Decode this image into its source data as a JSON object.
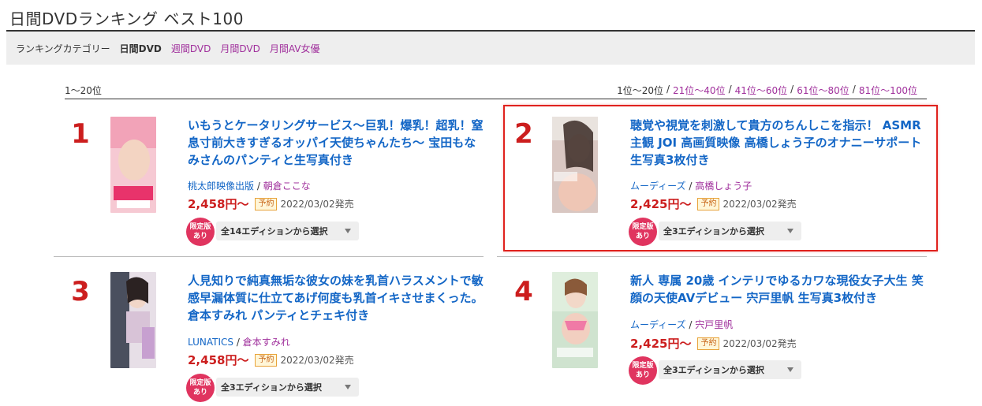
{
  "page_title": "日間DVDランキング ベスト100",
  "category_bar": {
    "label": "ランキングカテゴリー",
    "current": "日間DVD",
    "links": [
      "週間DVD",
      "月間DVD",
      "月間AV女優"
    ]
  },
  "range_label": "1〜20位",
  "pager": {
    "current": "1位〜20位",
    "links": [
      "21位〜40位",
      "41位〜60位",
      "61位〜80位",
      "81位〜100位"
    ],
    "separator": "/"
  },
  "items": [
    {
      "rank": "1",
      "title": "いもうとケータリングサービス〜巨乳！爆乳！超乳！窒息寸前大きすぎるオッパイ天使ちゃんたち〜 宝田もなみさんのパンティと生写真付き",
      "maker": "桃太郎映像出版",
      "actress": "朝倉ここな",
      "price": "2,458円〜",
      "badge": "予約",
      "release": "2022/03/02発売",
      "limited_line1": "限定版",
      "limited_line2": "あり",
      "edition": "全14エディションから選択"
    },
    {
      "rank": "2",
      "title": "聴覚や視覚を刺激して貴方のちんしこを指示！ ASMR主観 JOI 高画質映像 高橋しょう子のオナニーサポート 生写真3枚付き",
      "maker": "ムーディーズ",
      "actress": "高橋しょう子",
      "price": "2,425円〜",
      "badge": "予約",
      "release": "2022/03/02発売",
      "limited_line1": "限定版",
      "limited_line2": "あり",
      "edition": "全3エディションから選択"
    },
    {
      "rank": "3",
      "title": "人見知りで純真無垢な彼女の妹を乳首ハラスメントで敏感早漏体質に仕立てあげ何度も乳首イキさせまくった。倉本すみれ パンティとチェキ付き",
      "maker": "LUNATICS",
      "actress": "倉本すみれ",
      "price": "2,458円〜",
      "badge": "予約",
      "release": "2022/03/02発売",
      "limited_line1": "限定版",
      "limited_line2": "あり",
      "edition": "全3エディションから選択"
    },
    {
      "rank": "4",
      "title": "新人 専属 20歳 インテリでゆるカワな現役女子大生 笑顔の天使AVデビュー 宍戸里帆 生写真3枚付き",
      "maker": "ムーディーズ",
      "actress": "宍戸里帆",
      "price": "2,425円〜",
      "badge": "予約",
      "release": "2022/03/02発売",
      "limited_line1": "限定版",
      "limited_line2": "あり",
      "edition": "全3エディションから選択"
    }
  ],
  "colors": {
    "rank": "#cc1e1e",
    "title_link": "#1366c6",
    "actress_link": "#a0309c",
    "price": "#cc1e1e",
    "limited_badge": "#e0345f",
    "highlight": "#e0221e"
  }
}
